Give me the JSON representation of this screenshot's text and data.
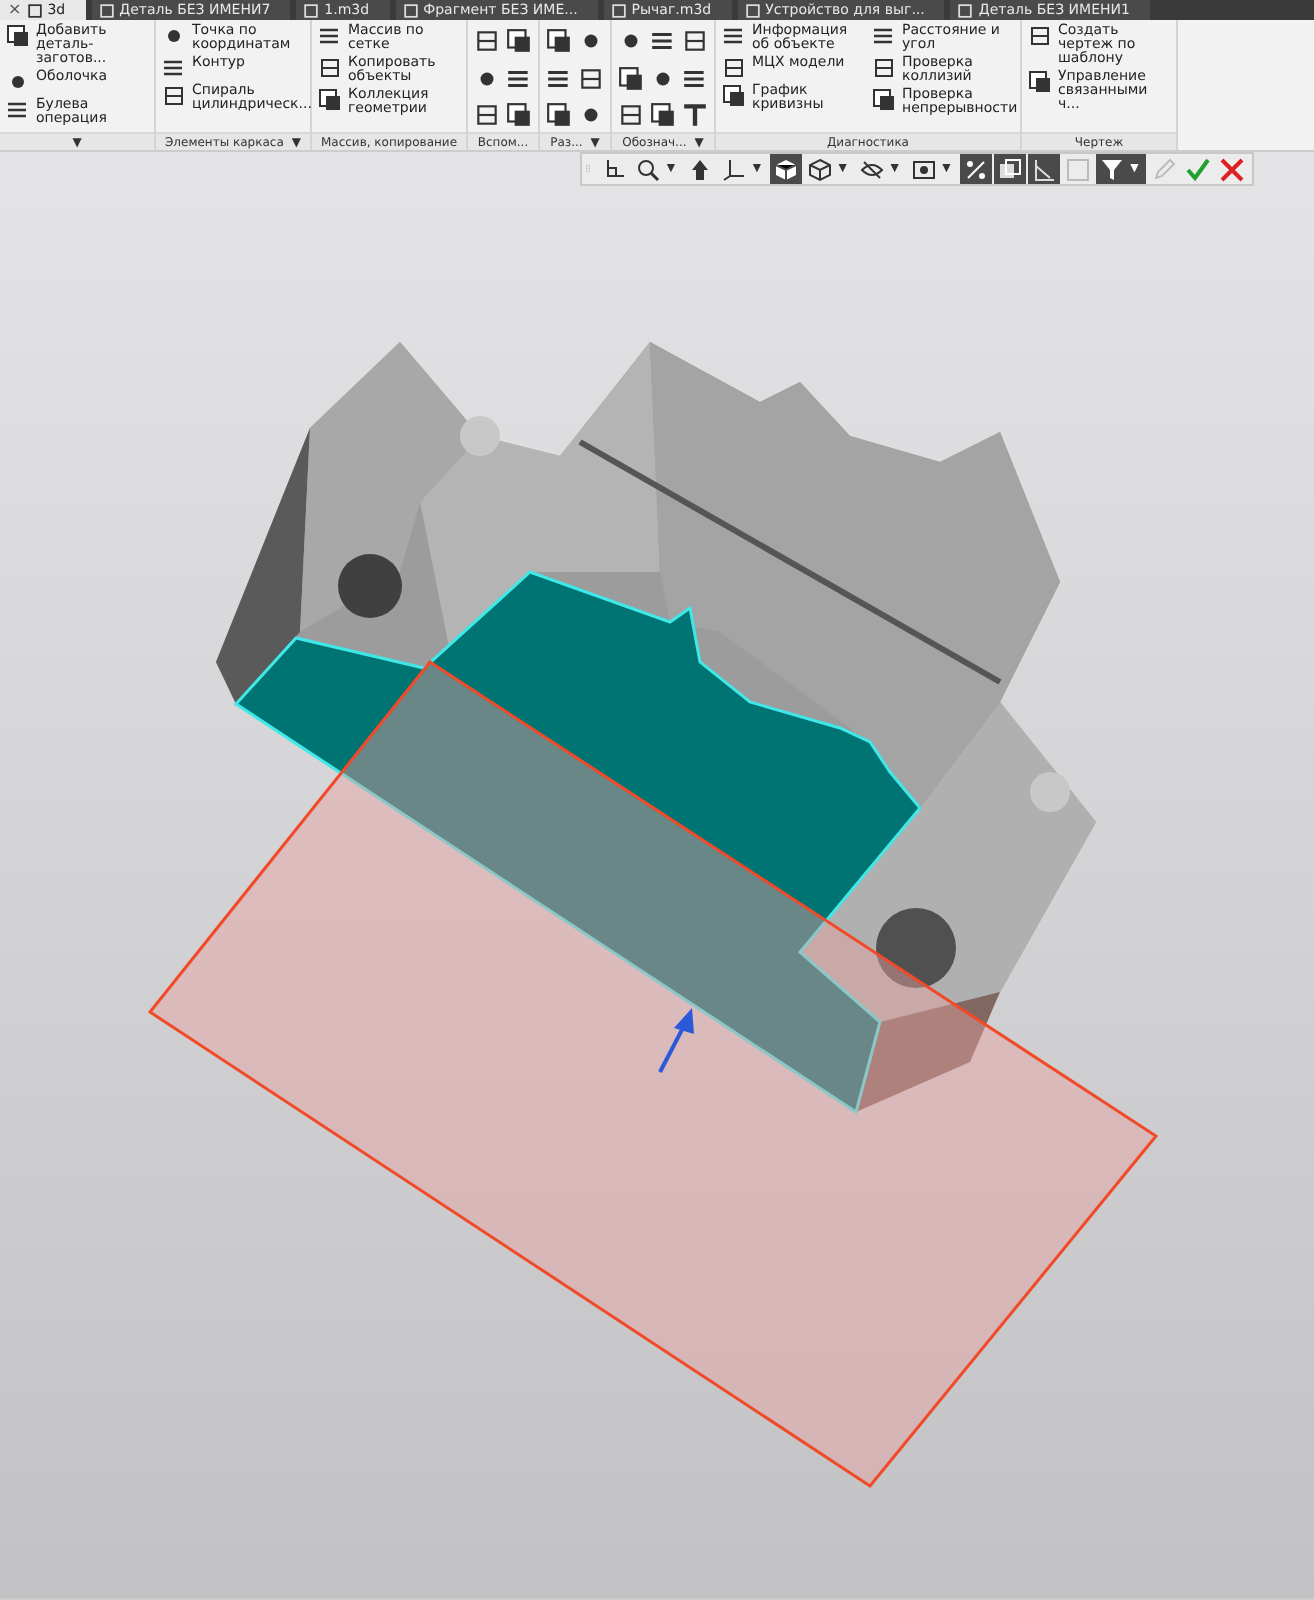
{
  "tabs": [
    {
      "label": "3d",
      "selected": true,
      "close": "×"
    },
    {
      "label": "Деталь БЕЗ ИМЕНИ7",
      "selected": false
    },
    {
      "label": "1.m3d",
      "selected": false
    },
    {
      "label": "Фрагмент БЕЗ ИМЕ...",
      "selected": false
    },
    {
      "label": "Рычаг.m3d",
      "selected": false
    },
    {
      "label": "Устройство для выг...",
      "selected": false
    },
    {
      "label": "Деталь БЕЗ ИМЕНИ1",
      "selected": false
    }
  ],
  "ribbon": [
    {
      "kind": "text",
      "menu_icon": "▼",
      "columns": [
        [
          {
            "label": "Добавить деталь-заготов..."
          },
          {
            "label": "Оболочка"
          },
          {
            "label": "Булева операция"
          }
        ]
      ]
    },
    {
      "kind": "text",
      "label": "Элементы каркаса",
      "menu_icon": "▼",
      "columns": [
        [
          {
            "label": "Точка по координатам"
          },
          {
            "label": "Контур"
          },
          {
            "label": "Спираль цилиндрическ..."
          }
        ]
      ]
    },
    {
      "kind": "text",
      "label": "Массив, копирование",
      "columns": [
        [
          {
            "label": "Массив по сетке"
          },
          {
            "label": "Копировать объекты"
          },
          {
            "label": "Коллекция геометрии"
          }
        ]
      ]
    },
    {
      "kind": "icons",
      "label": "Вспом..."
    },
    {
      "kind": "icons",
      "label": "Раз...",
      "menu_icon": "▼"
    },
    {
      "kind": "icons",
      "label": "Обознач...",
      "menu_icon": "▼"
    },
    {
      "kind": "text",
      "label": "Диагностика",
      "columns": [
        [
          {
            "label": "Информация об объекте"
          },
          {
            "label": "МЦХ модели"
          },
          {
            "label": "График кривизны"
          }
        ],
        [
          {
            "label": "Расстояние и угол"
          },
          {
            "label": "Проверка коллизий"
          },
          {
            "label": "Проверка непрерывности"
          }
        ]
      ]
    },
    {
      "kind": "text",
      "label": "Чертеж",
      "columns": [
        [
          {
            "label": "Создать чертеж по шаблону"
          },
          {
            "label": "Управление связанными ч..."
          }
        ]
      ]
    }
  ],
  "view_toolbar": [
    {
      "kind": "frame",
      "on": false
    },
    {
      "kind": "zoom",
      "on": false,
      "menu_icon": "▼"
    },
    {
      "kind": "orient",
      "on": false
    },
    {
      "kind": "axes",
      "on": false,
      "menu_icon": "▼"
    },
    {
      "kind": "shaded",
      "on": true
    },
    {
      "kind": "wire",
      "on": false,
      "menu_icon": "▼"
    },
    {
      "kind": "hide",
      "on": false,
      "menu_icon": "▼"
    },
    {
      "kind": "display",
      "on": false,
      "menu_icon": "▼"
    },
    {
      "kind": "snap",
      "on": true
    },
    {
      "kind": "layers",
      "on": true
    },
    {
      "kind": "grid",
      "on": true
    },
    {
      "kind": "sketch",
      "on": false
    },
    {
      "kind": "filter",
      "on": true,
      "menu_icon": "▼"
    },
    {
      "kind": "pencil",
      "on": false
    },
    {
      "kind": "ok",
      "on": false
    },
    {
      "kind": "cancel",
      "on": false
    }
  ]
}
